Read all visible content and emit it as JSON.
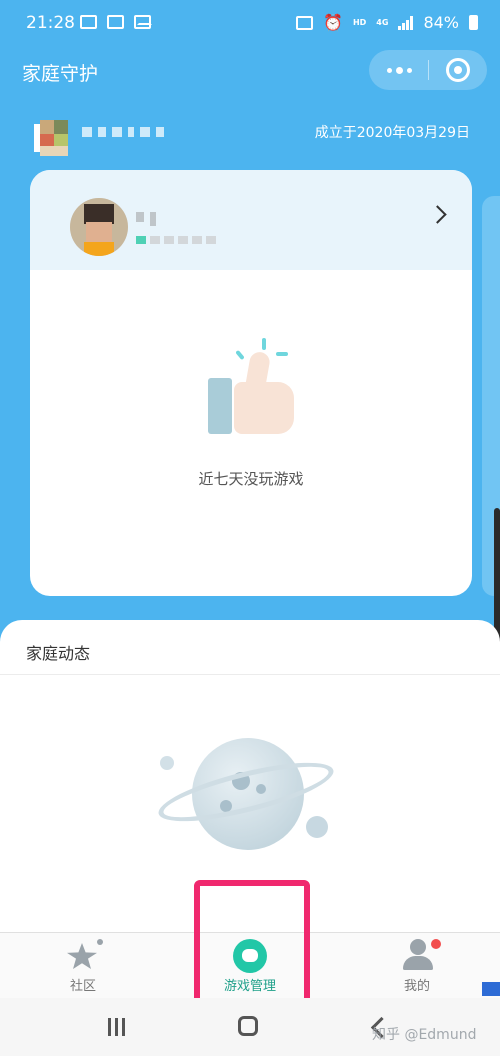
{
  "status_bar": {
    "time": "21:28",
    "network_hd": "HD",
    "network_type": "4G",
    "battery_percent": "84%"
  },
  "header": {
    "title": "家庭守护"
  },
  "family": {
    "founded_text": "成立于2020年03月29日"
  },
  "child_card": {
    "empty_text": "近七天没玩游戏"
  },
  "activity": {
    "title": "家庭动态"
  },
  "tabbar": {
    "tabs": [
      {
        "label": "社区"
      },
      {
        "label": "游戏管理"
      },
      {
        "label": "我的"
      }
    ],
    "active_color": "#1fa08a"
  },
  "watermark": {
    "text": "知乎 @Edmund"
  },
  "colors": {
    "background": "#4cb4ef",
    "highlight": "#f0286e"
  }
}
